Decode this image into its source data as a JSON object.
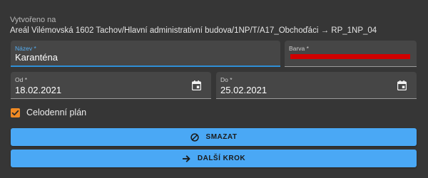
{
  "created": {
    "label": "Vytvořeno na",
    "path": "Areál Vilémovská 1602 Tachov/Hlavní administrativní budova/1NP/T/A17_Obchoďáci → RP_1NP_04"
  },
  "form": {
    "name": {
      "label": "Název *",
      "value": "Karanténa"
    },
    "color": {
      "label": "Barva *",
      "value_hex": "#d10000"
    },
    "from": {
      "label": "Od *",
      "value": "18.02.2021",
      "icon": "calendar-icon"
    },
    "to": {
      "label": "Do *",
      "value": "25.02.2021",
      "icon": "calendar-icon"
    },
    "all_day": {
      "label": "Celodenní plán",
      "checked": true
    }
  },
  "actions": {
    "delete_label": "SMAZAT",
    "delete_icon": "block-icon",
    "next_label": "DALŠÍ KROK",
    "next_icon": "arrow-right-icon"
  },
  "colors": {
    "background": "#363636",
    "field_bg": "#464646",
    "accent_blue": "#4aa8f5",
    "focus_blue": "#2f8fd6",
    "checkbox_orange": "#f08a24",
    "swatch_red": "#d10000"
  }
}
